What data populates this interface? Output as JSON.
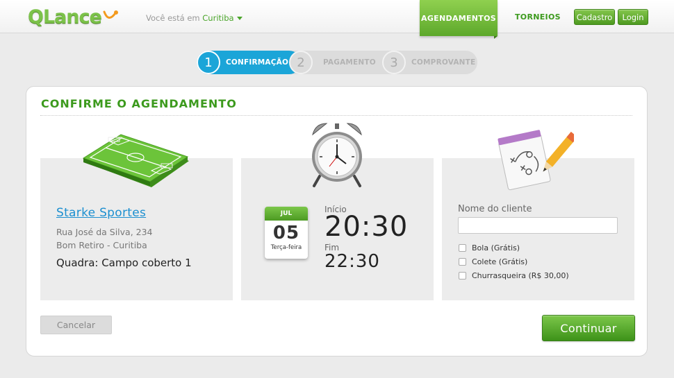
{
  "header": {
    "logo_text": "QLance",
    "location_prefix": "Você está em",
    "location_city": "Curitiba",
    "nav": [
      {
        "label": "AGENDAMENTOS",
        "active": true
      },
      {
        "label": "TORNEIOS",
        "active": false
      }
    ],
    "signup_label": "Cadastro",
    "login_label": "Login"
  },
  "stepper": {
    "steps": [
      {
        "number": "1",
        "label": "CONFIRMAÇÃO",
        "active": true
      },
      {
        "number": "2",
        "label": "PAGAMENTO",
        "active": false
      },
      {
        "number": "3",
        "label": "COMPROVANTE",
        "active": false
      }
    ]
  },
  "card": {
    "title": "CONFIRME O AGENDAMENTO"
  },
  "venue": {
    "name": "Starke Sportes",
    "address_line1": "Rua José da Silva, 234",
    "address_line2": "Bom Retiro - Curitiba",
    "court": "Quadra: Campo coberto 1",
    "icon": "soccer-field-icon"
  },
  "schedule": {
    "month": "JUL",
    "day": "05",
    "weekday": "Terça-feira",
    "start_label": "Início",
    "start_time": "20:30",
    "end_label": "Fim",
    "end_time": "22:30",
    "icon": "alarm-clock-icon"
  },
  "form": {
    "client_label": "Nome do cliente",
    "client_value": "",
    "client_placeholder": "",
    "options": [
      {
        "label": "Bola (Grátis)",
        "checked": false
      },
      {
        "label": "Colete (Grátis)",
        "checked": false
      },
      {
        "label": "Churrasqueira (R$ 30,00)",
        "checked": false
      }
    ],
    "icon": "notepad-strategy-icon"
  },
  "actions": {
    "cancel_label": "Cancelar",
    "continue_label": "Continuar"
  },
  "colors": {
    "brand_green": "#5da82b",
    "accent_blue": "#1ba5d8",
    "link_blue": "#1c8fd0"
  }
}
